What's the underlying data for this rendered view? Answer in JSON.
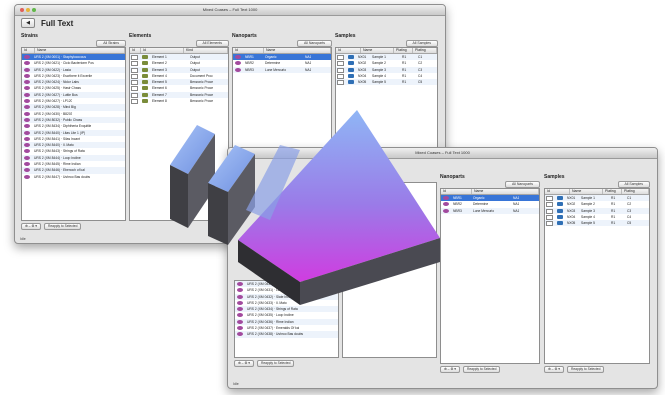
{
  "back_window": {
    "title": "Mixed Coases – Full Text 1000",
    "header_title": "Full Text",
    "status_text": "Idle",
    "strains": {
      "heading": "Strains",
      "filter": "All Strains",
      "cols": [
        "Id",
        "Name"
      ],
      "rows": [
        "URS 2 (XM 0001) · Staphylococcus",
        "URS 2 (XM 0421) · Ciclo Bacteriorm Pos",
        "URS 2 (XM 0422) · Lasia",
        "URS 2 (XM 0423) · Escribere it Excerile",
        "URS 2 (XM 0424) · Nidor Labs",
        "URS 2 (XM 0425) · Hasir Chass",
        "URS 2 (XM 0427) · Luttle Bus",
        "URS 2 (XM 0427) · LP120",
        "URS 2 (XM 0428) · Mind Big",
        "URS 2 (XM 0430) · B8203",
        "URS 2 (XM 8032) · Public Chass",
        "URS 2 (XM 8434) · Diphtheria Exquitile",
        "URS 2 (XM 8440) · Litas Lite 1 (IP)",
        "URS 2 (XM 8441) · Silas Incant",
        "URS 2 (XM 8440) · Il. Mato",
        "URS 2 (XM 8443) · Strings of Rata",
        "URS 2 (XM 8444) · Loop Incline",
        "URS 2 (XM 8445) · Rime Indian",
        "URS 2 (XM 8446) · Ebenoch of kal",
        "URS 2 (XM 8447) · Ushroo Bas doubs"
      ],
      "bottom_left": "⊕ – ⚙ ▾",
      "bottom_right": "Reapply to Selected"
    },
    "elements": {
      "heading": "Elements",
      "filter": "All Elements",
      "cols": [
        "Id",
        "Id",
        "Kind"
      ],
      "rows": [
        [
          "Element 1",
          "Output"
        ],
        [
          "Element 2",
          "Output"
        ],
        [
          "Element 3",
          "Output"
        ],
        [
          "Element 4",
          "Document Proc"
        ],
        [
          "Element 5",
          "Benzonic Proce"
        ],
        [
          "Element 6",
          "Benzonic Proce"
        ],
        [
          "Element 7",
          "Benzonic Proce"
        ],
        [
          "Element 8",
          "Benzonic Proce"
        ]
      ]
    },
    "nanoparts": {
      "heading": "Nanoparts",
      "filter": "All Nanoparts",
      "cols": [
        "Id",
        "Name"
      ],
      "rows": [
        [
          "NBR1",
          "Organic",
          "NA1"
        ],
        [
          "NBR2",
          "Determine",
          "NA1"
        ],
        [
          "NBR3",
          "Lune Mercurio",
          "NA1"
        ]
      ]
    },
    "samples": {
      "heading": "Samples",
      "filter": "All Samples",
      "cols": [
        "Id",
        "Name",
        "Plating",
        "Plating"
      ],
      "rows": [
        [
          "NX01",
          "Sample 1",
          "R1",
          "C1"
        ],
        [
          "NX02",
          "Sample 2",
          "R1",
          "C2"
        ],
        [
          "NX03",
          "Sample 3",
          "R1",
          "C3"
        ],
        [
          "NX04",
          "Sample 4",
          "R1",
          "C4"
        ],
        [
          "NX05",
          "Sample 5",
          "R1",
          "C5"
        ]
      ]
    }
  },
  "front_window": {
    "title": "Mixed Coases – Full Text 1000",
    "status_text": "Idle",
    "strains": {
      "rows": [
        "URS 2 (XM 0430) · Staphylococcus & Incendie",
        "URS 2 (XM 0431) · Ledo Tine 1 (IP)",
        "URS 2 (XM 0432) · Slate Incicent",
        "URS 2 (XM 0433) · Il. Mato",
        "URS 2 (XM 0434) · Strings of Rata",
        "URS 2 (XM 0435) · Loop Incline",
        "URS 2 (XM 0436) · Rime Indian",
        "URS 2 (XM 0437) · Emeralds Of kal",
        "URS 2 (XM 0438) · Ushroo Bas doubs"
      ],
      "bottom_left": "⊕ – ⚙ ▾",
      "bottom_right": "Reapply to Selected"
    },
    "nanoparts": {
      "heading": "Nanoparts",
      "filter": "All Nanoparts",
      "cols": [
        "Id",
        "Name"
      ],
      "rows": [
        [
          "NBR1",
          "Organic",
          "NA1"
        ],
        [
          "NBR2",
          "Determine",
          "NA1"
        ],
        [
          "NBR3",
          "Lune Mercurio",
          "NA1"
        ]
      ],
      "bottom_left": "⊕ – ⚙ ▾",
      "bottom_right": "Reapply to Selected"
    },
    "samples": {
      "heading": "Samples",
      "filter": "All Samples",
      "cols": [
        "Id",
        "Name",
        "Plating",
        "Plating"
      ],
      "rows": [
        [
          "NX01",
          "Sample 1",
          "R1",
          "C1"
        ],
        [
          "NX02",
          "Sample 2",
          "R1",
          "C2"
        ],
        [
          "NX03",
          "Sample 3",
          "R1",
          "C3"
        ],
        [
          "NX04",
          "Sample 4",
          "R1",
          "C4"
        ],
        [
          "NX05",
          "Sample 5",
          "R1",
          "C5"
        ]
      ],
      "bottom_left": "⊕ – ⚙ ▾",
      "bottom_right": "Reapply to Selected"
    }
  },
  "overlay": {
    "icon": "arrow-up-icon",
    "colors": {
      "top": "#7fa7f0",
      "bottom": "#c040e0",
      "side": "#3a3a3a"
    }
  }
}
